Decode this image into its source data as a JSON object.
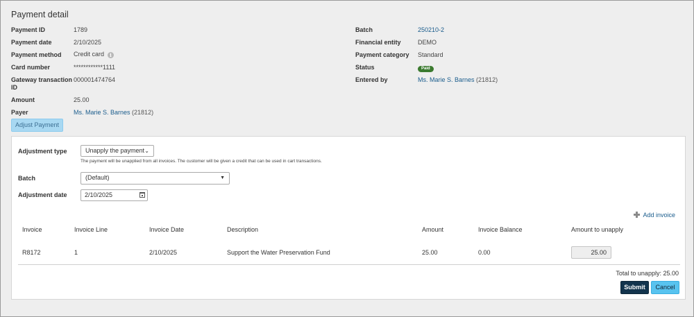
{
  "page": {
    "title": "Payment detail"
  },
  "detail": {
    "left": [
      {
        "label": "Payment ID",
        "value": "1789"
      },
      {
        "label": "Payment date",
        "value": "2/10/2025"
      },
      {
        "label": "Payment method",
        "value": "Credit card"
      },
      {
        "label": "Card number",
        "value": "************1111"
      },
      {
        "label_line1": "Gateway transaction",
        "label_line2": "ID",
        "value": "000001474764"
      },
      {
        "label": "Amount",
        "value": "25.00"
      },
      {
        "label": "Payer",
        "value_link": "Ms. Marie S. Barnes",
        "value_suffix": "(21812)"
      }
    ],
    "right": [
      {
        "label": "Batch",
        "value_link": "250210-2"
      },
      {
        "label": "Financial entity",
        "value": "DEMO"
      },
      {
        "label": "Payment category",
        "value": "Standard"
      },
      {
        "label": "Status",
        "badge": "Paid"
      },
      {
        "label": "Entered by",
        "value_link": "Ms. Marie S. Barnes",
        "value_suffix": "(21812)"
      }
    ],
    "info_icon": "info-icon"
  },
  "adjust_button": "Adjust Payment",
  "adjustment": {
    "type_label": "Adjustment type",
    "type_value": "Unapply the payment",
    "type_help": "The payment will be unapplied from all invoices. The customer will be given a credit that can be used in cart transactions.",
    "batch_label": "Batch",
    "batch_value": "(Default)",
    "date_label": "Adjustment date",
    "date_value": "2/10/2025",
    "add_invoice": "Add invoice"
  },
  "invoice_table": {
    "columns": [
      "Invoice",
      "Invoice Line",
      "Invoice Date",
      "Description",
      "Amount",
      "Invoice Balance",
      "Amount to unapply"
    ],
    "rows": [
      {
        "invoice": "R8172",
        "line": "1",
        "date": "2/10/2025",
        "description": "Support the Water Preservation Fund",
        "amount": "25.00",
        "balance": "0.00",
        "unapply": "25.00"
      }
    ]
  },
  "total": {
    "label": "Total to unapply:",
    "value": "25.00"
  },
  "actions": {
    "submit": "Submit",
    "cancel": "Cancel"
  },
  "colors": {
    "link": "#1a5c8c",
    "paid_badge": "#3b7a2f",
    "submit_bg": "#13344d",
    "cancel_bg": "#58c3ef",
    "adjust_bg": "#a8d8f2"
  }
}
